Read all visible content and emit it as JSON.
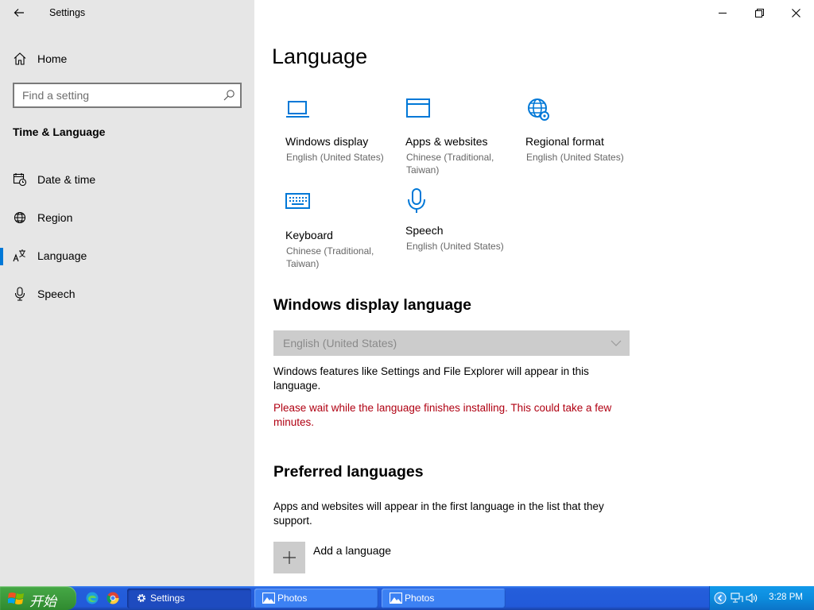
{
  "app": {
    "title": "Settings"
  },
  "sidebar": {
    "home_label": "Home",
    "search_placeholder": "Find a setting",
    "section_title": "Time & Language",
    "items": [
      {
        "label": "Date & time",
        "icon": "calendar-clock-icon"
      },
      {
        "label": "Region",
        "icon": "globe-icon"
      },
      {
        "label": "Language",
        "icon": "language-icon",
        "active": true
      },
      {
        "label": "Speech",
        "icon": "microphone-icon"
      }
    ]
  },
  "main": {
    "title": "Language",
    "tiles": [
      {
        "label": "Windows display",
        "sub": "English (United States)",
        "icon": "monitor-icon"
      },
      {
        "label": "Apps & websites",
        "sub": "Chinese (Traditional, Taiwan)",
        "icon": "window-icon"
      },
      {
        "label": "Regional format",
        "sub": "English (United States)",
        "icon": "globe-settings-icon"
      },
      {
        "label": "Keyboard",
        "sub": "Chinese (Traditional, Taiwan)",
        "icon": "keyboard-icon"
      },
      {
        "label": "Speech",
        "sub": "English (United States)",
        "icon": "microphone-icon"
      }
    ],
    "display_language": {
      "heading": "Windows display language",
      "selected": "English (United States)",
      "description": "Windows features like Settings and File Explorer will appear in this language.",
      "warning": "Please wait while the language finishes installing. This could take a few minutes."
    },
    "preferred": {
      "heading": "Preferred languages",
      "description": "Apps and websites will appear in the first language in the list that they support.",
      "add_label": "Add a language"
    }
  },
  "taskbar": {
    "start_label": "开始",
    "tasks": [
      {
        "label": "Settings",
        "active": true
      },
      {
        "label": "Photos",
        "active": false
      },
      {
        "label": "Photos",
        "active": false
      }
    ],
    "clock": "3:28 PM"
  },
  "colors": {
    "accent": "#0078d7",
    "warning": "#b00012",
    "sidebar_bg": "#e6e6e6"
  }
}
